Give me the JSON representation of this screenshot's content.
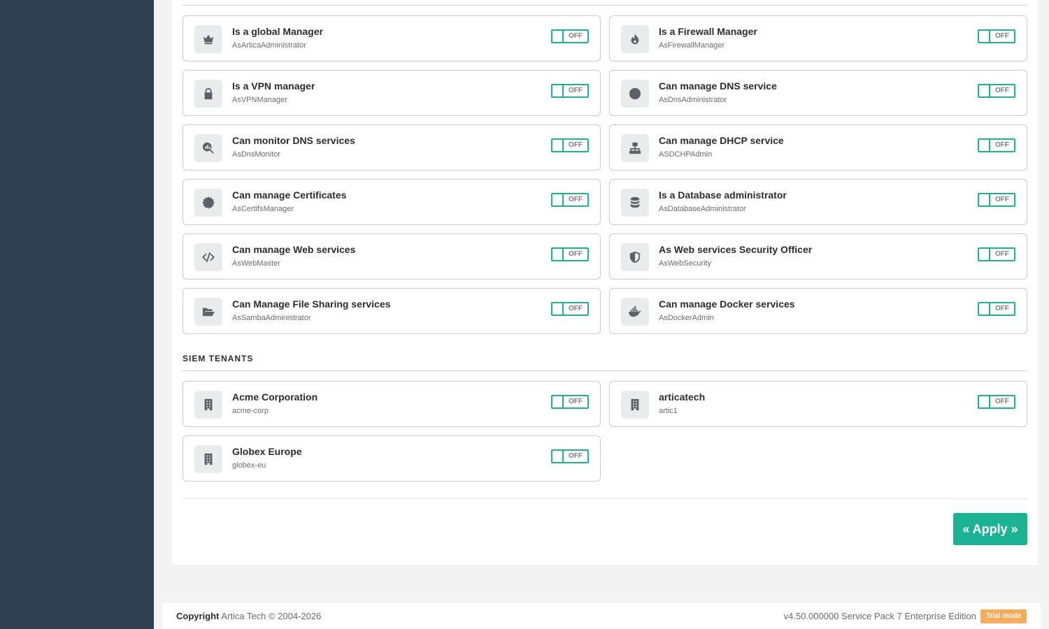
{
  "roles": [
    {
      "title": "Is a global Manager",
      "sub": "AsArticaAdministrator",
      "icon": "crown-icon",
      "state": "OFF"
    },
    {
      "title": "Is a Firewall Manager",
      "sub": "AsFirewallManager",
      "icon": "fire-icon",
      "state": "OFF"
    },
    {
      "title": "Is a VPN manager",
      "sub": "AsVPNManager",
      "icon": "lock-icon",
      "state": "OFF"
    },
    {
      "title": "Can manage DNS service",
      "sub": "AsDnsAdministrator",
      "icon": "globe-icon",
      "state": "OFF"
    },
    {
      "title": "Can monitor DNS services",
      "sub": "AsDnsMonitor",
      "icon": "magnify-chart-icon",
      "state": "OFF"
    },
    {
      "title": "Can manage DHCP service",
      "sub": "ASDCHPAdmin",
      "icon": "network-icon",
      "state": "OFF"
    },
    {
      "title": "Can manage Certificates",
      "sub": "AsCertifsManager",
      "icon": "certificate-icon",
      "state": "OFF"
    },
    {
      "title": "Is a Database administrator",
      "sub": "AsDatabaseAdministrator",
      "icon": "database-icon",
      "state": "OFF"
    },
    {
      "title": "Can manage Web services",
      "sub": "AsWebMaster",
      "icon": "code-icon",
      "state": "OFF"
    },
    {
      "title": "As Web services Security Officer",
      "sub": "AsWebSecurity",
      "icon": "shield-icon",
      "state": "OFF"
    },
    {
      "title": "Can Manage File Sharing services",
      "sub": "AsSambaAdministrator",
      "icon": "folder-open-icon",
      "state": "OFF"
    },
    {
      "title": "Can manage Docker services",
      "sub": "AsDockerAdmin",
      "icon": "docker-icon",
      "state": "OFF"
    }
  ],
  "siem": {
    "title": "SIEM TENANTS",
    "tenants": [
      {
        "title": "Acme Corporation",
        "sub": "acme-corp",
        "icon": "building-icon",
        "state": "OFF"
      },
      {
        "title": "articatech",
        "sub": "artic1",
        "icon": "building-icon",
        "state": "OFF"
      },
      {
        "title": "Globex Europe",
        "sub": "globex-eu",
        "icon": "building-icon",
        "state": "OFF"
      }
    ]
  },
  "apply_label": "« Apply »",
  "footer": {
    "copyright_label": "Copyright",
    "copyright_text": "Artica Tech © 2004-2026",
    "version": "v4.50.000000 Service Pack 7 Enterprise Edition",
    "badge": "Trial mode"
  },
  "colors": {
    "accent": "#1ab394",
    "sidebar": "#2f4050",
    "badge": "#f8ac59"
  }
}
